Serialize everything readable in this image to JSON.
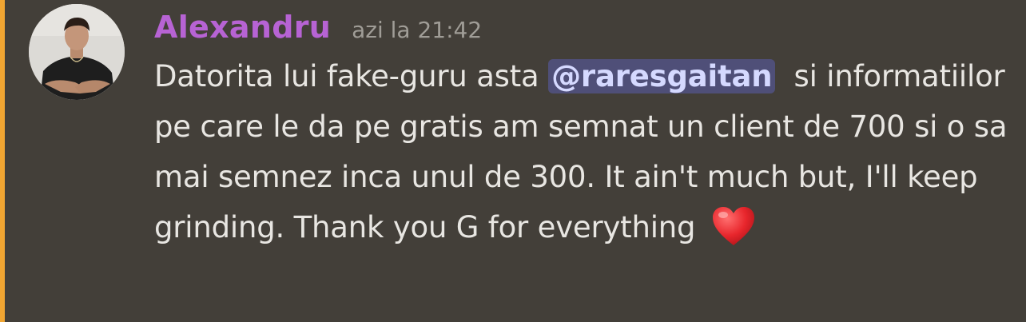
{
  "message": {
    "author": "Alexandru",
    "timestamp": "azi la 21:42",
    "text_before_mention": "Datorita lui fake-guru asta ",
    "mention": "@raresgaitan",
    "text_after_mention": "  si informatiilor pe care le da pe gratis am semnat un client de 700 si o sa mai semnez inca unul de 300. It ain't much but, I'll keep grinding. Thank you G for everything ",
    "emoji": "red-heart-icon"
  },
  "colors": {
    "background": "#433f39",
    "highlight_bar": "#f0a532",
    "username": "#b763d4",
    "timestamp": "#a09d97",
    "text": "#e8e6e2",
    "mention_bg": "#4f4f78",
    "mention_text": "#d5d9ff"
  }
}
